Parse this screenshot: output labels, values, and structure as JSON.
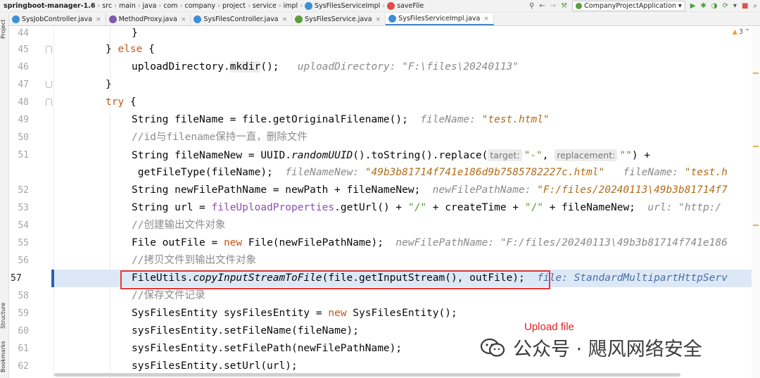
{
  "breadcrumb": {
    "project": "springboot-manager-1.6",
    "path": [
      "src",
      "main",
      "java",
      "com",
      "company",
      "project",
      "service",
      "impl"
    ],
    "class_name": "SysFilesServiceImpl",
    "method_name": "saveFile"
  },
  "toolbar": {
    "run_config": "CompanyProjectApplication"
  },
  "tabs": [
    {
      "label": "SysJobController.java",
      "icon_color": "#3c8fd8",
      "active": false
    },
    {
      "label": "MethodProxy.java",
      "icon_color": "#7a5ab5",
      "active": false
    },
    {
      "label": "SysFilesController.java",
      "icon_color": "#3c8fd8",
      "active": false
    },
    {
      "label": "SysFilesService.java",
      "icon_color": "#5a9e3a",
      "active": false
    },
    {
      "label": "SysFilesServiceImpl.java",
      "icon_color": "#3c8fd8",
      "active": true
    }
  ],
  "left_tool_labels": {
    "project": "Project",
    "structure": "Structure",
    "bookmarks": "Bookmarks"
  },
  "inspections": {
    "warnings": "3"
  },
  "line_numbers": [
    "44",
    "45",
    "46",
    "47",
    "48",
    "49",
    "50",
    "51",
    "",
    "52",
    "53",
    "54",
    "55",
    "56",
    "57",
    "58",
    "59",
    "60",
    "61",
    "62"
  ],
  "code": {
    "l44": "}",
    "l45_a": "} ",
    "l45_kw": "else",
    "l45_b": " {",
    "l46_a": "uploadDirectory.",
    "l46_m": "mkdir",
    "l46_b": "();",
    "l46_dbg_k": "uploadDirectory: ",
    "l46_dbg_v": "\"F:\\files\\20240113\"",
    "l47": "}",
    "l48_kw": "try",
    "l48_b": " {",
    "l49_a": "String fileName = file.getOriginalFilename();",
    "l49_dbg_k": "fileName: ",
    "l49_dbg_v": "\"test.html\"",
    "l50": "//id与filename保持一直，删除文件",
    "l51_a": "String fileNameNew = UUID.",
    "l51_m": "randomUUID",
    "l51_b": "().toString().replace(",
    "l51_h1": "target:",
    "l51_s1": "\"-\"",
    "l51_c": ", ",
    "l51_h2": "replacement:",
    "l51_s2": "\"\"",
    "l51_d": ") +",
    "l51b_a": " getFileType(fileName);",
    "l51b_dbg_k1": "fileNameNew: ",
    "l51b_dbg_v1": "\"49b3b81714f741e186d9b7585782227c.html\"",
    "l51b_dbg_k2": "fileName: ",
    "l51b_dbg_v2": "\"test.h",
    "l52_a": "String newFilePathName = newPath + fileNameNew;",
    "l52_dbg_k": "newFilePathName: ",
    "l52_dbg_v": "\"F:/files/20240113\\49b3b81714f7",
    "l53_a": "String url = ",
    "l53_f": "fileUploadProperties",
    "l53_b": ".getUrl() + ",
    "l53_s1": "\"/\"",
    "l53_c": " + createTime + ",
    "l53_s2": "\"/\"",
    "l53_d": " + fileNameNew;",
    "l53_dbg_k": "url: ",
    "l53_dbg_v": "\"http:/",
    "l54": "//创建输出文件对象",
    "l55_a": "File outFile = ",
    "l55_kw": "new",
    "l55_b": " File(newFilePathName);",
    "l55_dbg_k": "newFilePathName: ",
    "l55_dbg_v": "\"F:/files/20240113\\49b3b81714f741e186",
    "l56": "//拷贝文件到输出文件对象",
    "l57_a": "FileUtils.",
    "l57_m": "copyInputStreamToFile",
    "l57_b": "(file.getInputStream(), outFile);",
    "l57_dbg": "file: StandardMultipartHttpServ",
    "l58": "//保存文件记录",
    "l59_a": "SysFilesEntity sysFilesEntity = ",
    "l59_kw": "new",
    "l59_b": " SysFilesEntity();",
    "l60": "sysFilesEntity.setFileName(fileName);",
    "l61": "sysFilesEntity.setFilePath(newFilePathName);",
    "l62": "sysFilesEntity.setUrl(url);"
  },
  "annotation": {
    "caption": "Upload file"
  },
  "watermark": {
    "text": "公众号 · 飓风网络安全"
  }
}
